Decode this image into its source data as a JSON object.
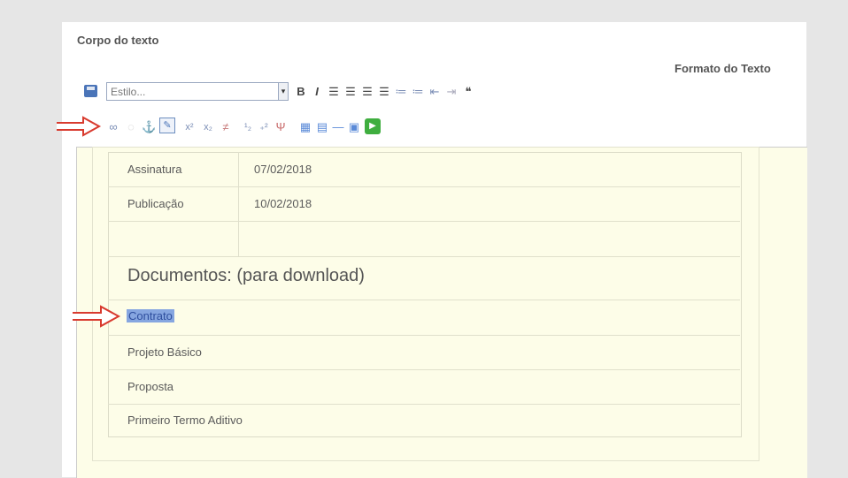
{
  "section": {
    "title": "Corpo do texto",
    "format_label": "Formato do Texto"
  },
  "toolbar": {
    "style_select": {
      "value": "Estilo..."
    },
    "row1_icons": [
      "save-icon",
      "bold-icon",
      "italic-icon",
      "align-left-icon",
      "align-center-icon",
      "align-right-icon",
      "justify-icon",
      "ordered-list-icon",
      "unordered-list-icon",
      "outdent-icon",
      "indent-icon",
      "blockquote-icon"
    ],
    "row2_icons": [
      "link-icon",
      "unlink-icon",
      "anchor-icon",
      "edit-icon",
      "superscript-icon",
      "subscript-icon",
      "strikethrough-icon",
      "special-char-icon",
      "symbol-icon",
      "filter-icon",
      "image-icon",
      "table-icon",
      "hr-icon",
      "media-icon",
      "play-icon"
    ]
  },
  "table": {
    "rows": [
      {
        "label": "Assinatura",
        "value": "07/02/2018"
      },
      {
        "label": "Publicação",
        "value": "10/02/2018"
      },
      {
        "label": "",
        "value": ""
      }
    ],
    "documents_heading": "Documentos: (para download)",
    "documents": [
      "Contrato",
      "Projeto Básico",
      "Proposta",
      "Primeiro Termo Aditivo"
    ]
  },
  "annotation_color": "#d83a2e",
  "highlight_color": "#86a6e0"
}
